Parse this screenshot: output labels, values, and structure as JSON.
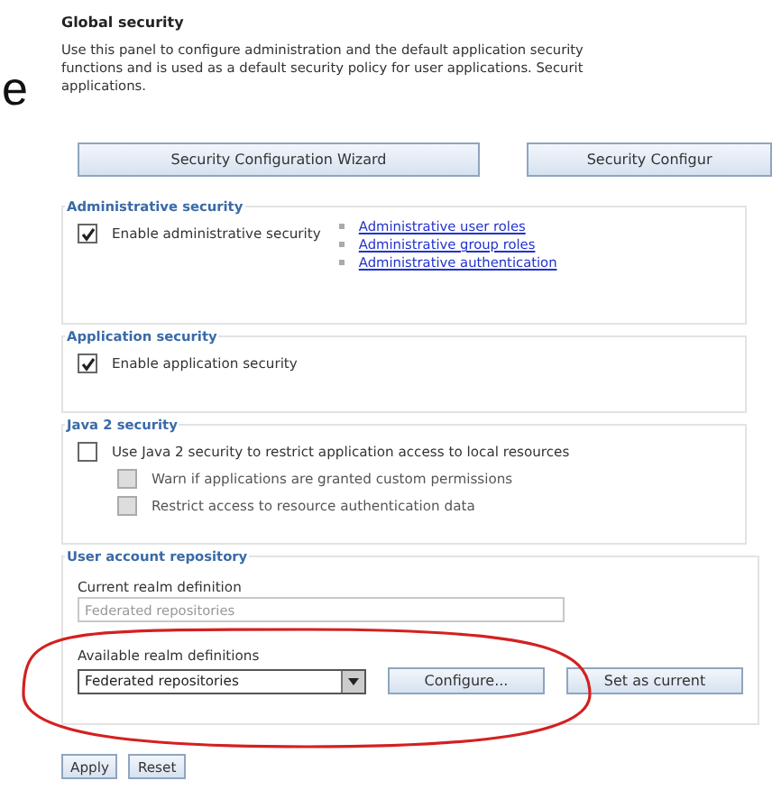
{
  "edge_fragment": "e",
  "panel": {
    "title": "Global security",
    "description_lines": [
      "Use this panel to configure administration and the default application security",
      "functions and is used as a default security policy for user applications. Securit",
      "applications."
    ]
  },
  "top_buttons": [
    "Security Configuration Wizard",
    "Security Configur"
  ],
  "administrative_security": {
    "legend": "Administrative security",
    "checkbox": {
      "label": "Enable administrative security",
      "checked": true,
      "disabled": false
    },
    "links": [
      "Administrative user roles",
      "Administrative group roles",
      "Administrative authentication"
    ]
  },
  "application_security": {
    "legend": "Application security",
    "checkbox": {
      "label": "Enable application security",
      "checked": true,
      "disabled": false
    }
  },
  "java2_security": {
    "legend": "Java 2 security",
    "checkbox": {
      "label": "Use Java 2 security to restrict application access to local resources",
      "checked": false,
      "disabled": false
    },
    "sub_checkboxes": [
      {
        "label": "Warn if applications are granted custom permissions",
        "checked": false,
        "disabled": true
      },
      {
        "label": "Restrict access to resource authentication data",
        "checked": false,
        "disabled": true
      }
    ]
  },
  "user_account_repository": {
    "legend": "User account repository",
    "current_label": "Current realm definition",
    "current_value": "Federated repositories",
    "available_label": "Available realm definitions",
    "available_value": "Federated repositories",
    "buttons": [
      "Configure...",
      "Set as current"
    ]
  },
  "annotations": [
    {
      "kind": "ellipse"
    }
  ],
  "bottom_buttons": [
    "Apply",
    "Reset"
  ]
}
